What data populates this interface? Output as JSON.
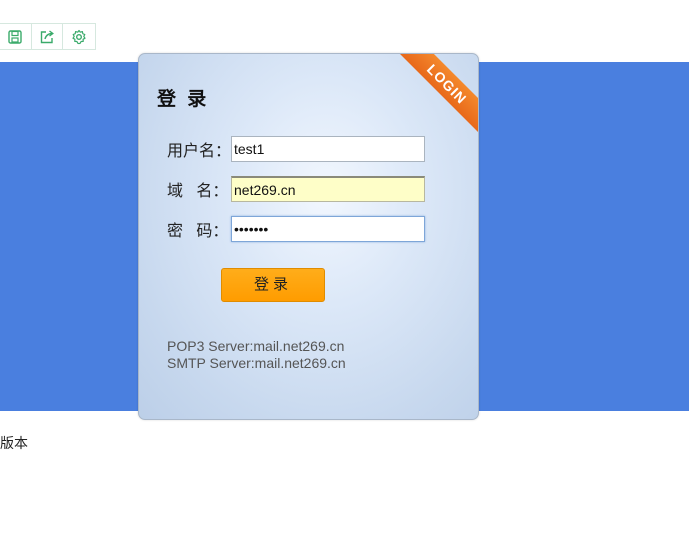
{
  "toolbar": {
    "buttons": [
      {
        "icon": "save-icon",
        "color": "#3aaa6a"
      },
      {
        "icon": "share-icon",
        "color": "#3aaa6a"
      },
      {
        "icon": "gear-icon",
        "color": "#3aaa6a"
      }
    ]
  },
  "colors": {
    "banner": "#4a7fdf",
    "ribbon": "#ef7a22",
    "login_button": "#ffa30a",
    "domain_field_bg": "#fefec8"
  },
  "login": {
    "ribbon_text": "LOGIN",
    "title": "登 录",
    "username_label": "用户名：",
    "username_value": "test1",
    "domain_label": "域   名：",
    "domain_value": "net269.cn",
    "password_label": "密   码：",
    "password_value": "1234567",
    "submit_label": "登录",
    "pop3": "POP3 Server:mail.net269.cn",
    "smtp": "SMTP Server:mail.net269.cn"
  },
  "footer": {
    "version_text": "版本"
  }
}
